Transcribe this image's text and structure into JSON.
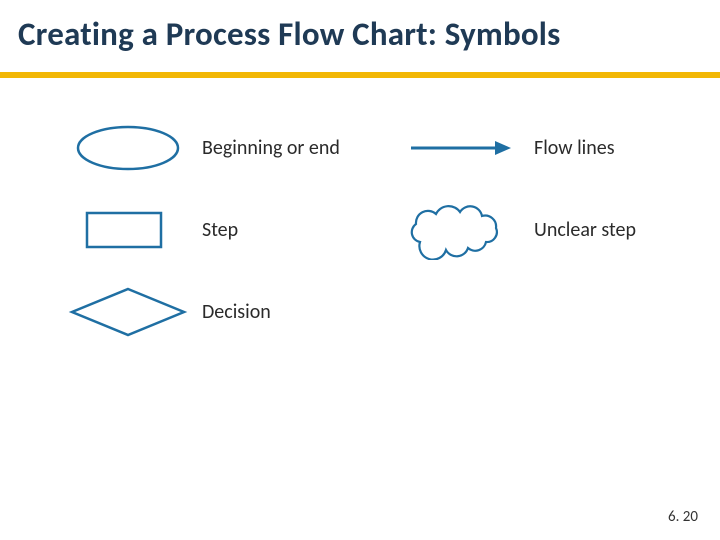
{
  "title": "Creating a Process Flow Chart: Symbols",
  "colors": {
    "accent_rule": "#f2b705",
    "symbol_stroke": "#1f6fa3",
    "title_text": "#1f3a55"
  },
  "symbols": {
    "terminator": {
      "label": "Beginning or end",
      "shape": "ellipse"
    },
    "step": {
      "label": "Step",
      "shape": "rectangle"
    },
    "decision": {
      "label": "Decision",
      "shape": "diamond"
    },
    "flow": {
      "label": "Flow lines",
      "shape": "arrow"
    },
    "unclear": {
      "label": "Unclear step",
      "shape": "cloud"
    }
  },
  "page_number": "6. 20"
}
